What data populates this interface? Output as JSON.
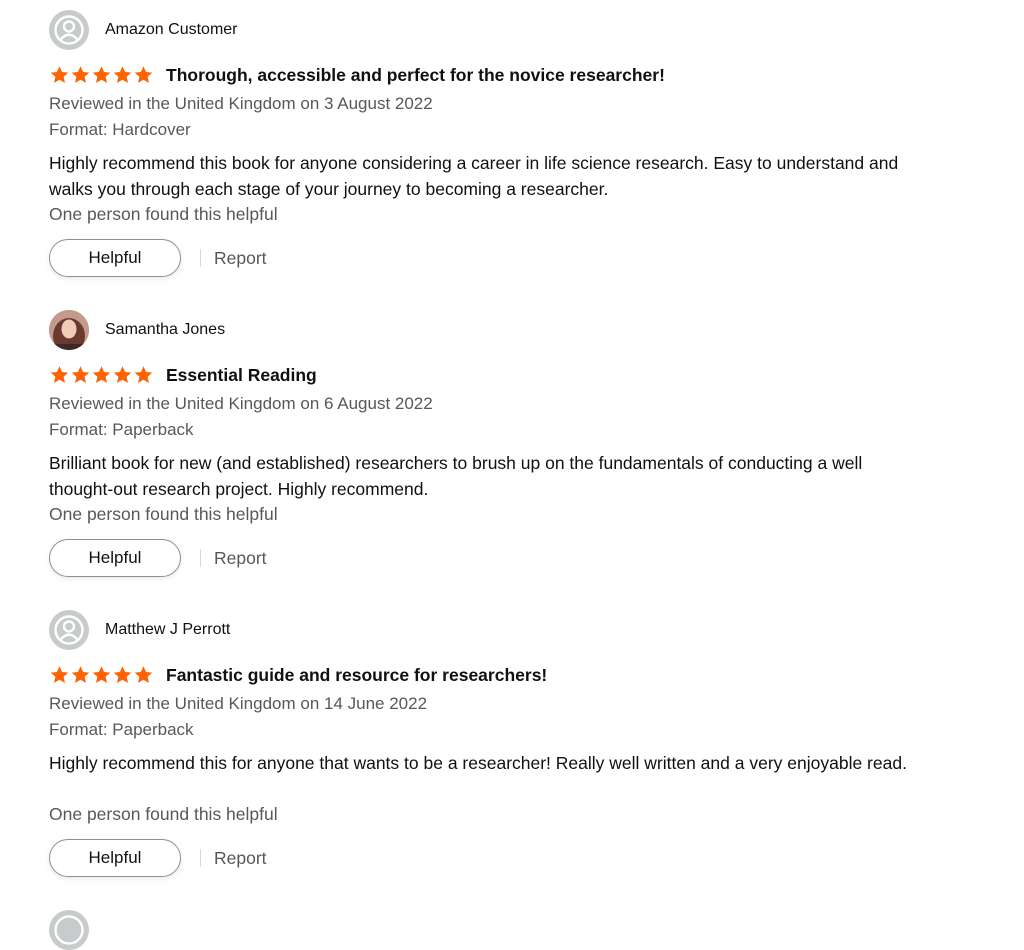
{
  "colors": {
    "star": "#ff6200",
    "text": "#0f1111",
    "muted": "#565959",
    "avatar_bg": "#d5d9d9"
  },
  "reviews": [
    {
      "reviewer": "Amazon Customer",
      "avatar": "default-user-icon",
      "rating": 5,
      "title": "Thorough, accessible and perfect for the novice researcher!",
      "date": "Reviewed in the United Kingdom on 3 August 2022",
      "format": "Format: Hardcover",
      "body": "Highly recommend this book for anyone considering a career in life science research. Easy to understand and walks you through each stage of your journey to becoming a researcher.",
      "helpful_count": "One person found this helpful",
      "helpful_label": "Helpful",
      "report_label": "Report"
    },
    {
      "reviewer": "Samantha Jones",
      "avatar": "user-photo",
      "rating": 5,
      "title": "Essential Reading",
      "date": "Reviewed in the United Kingdom on 6 August 2022",
      "format": "Format: Paperback",
      "body": "Brilliant book for new (and established) researchers to brush up on the fundamentals of conducting a well thought-out research project. Highly recommend.",
      "helpful_count": "One person found this helpful",
      "helpful_label": "Helpful",
      "report_label": "Report"
    },
    {
      "reviewer": "Matthew J Perrott",
      "avatar": "default-user-icon",
      "rating": 5,
      "title": "Fantastic guide and resource for researchers!",
      "date": "Reviewed in the United Kingdom on 14 June 2022",
      "format": "Format: Paperback",
      "body": "Highly recommend this for anyone that wants to be a researcher! Really well written and a very enjoyable read.",
      "helpful_count": "One person found this helpful",
      "helpful_label": "Helpful",
      "report_label": "Report"
    }
  ]
}
